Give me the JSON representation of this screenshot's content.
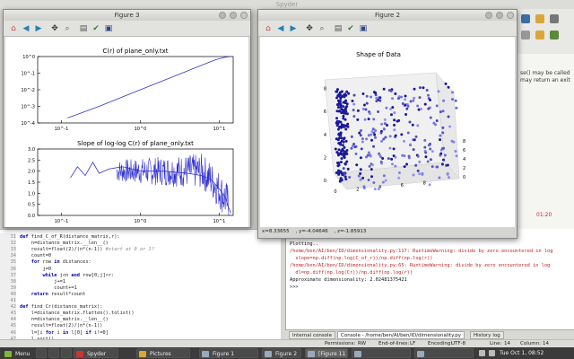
{
  "spyder": {
    "title": "Spyder",
    "doc_lines": [
      "se() may be called",
      "may return an exit"
    ],
    "timer": "01:20"
  },
  "editor": {
    "lines": [
      {
        "n": "31",
        "segs": [
          [
            "kw",
            "def "
          ],
          [
            "",
            "find_C_of_R(distance_matrix,r):"
          ]
        ]
      },
      {
        "n": "32",
        "segs": [
          [
            "",
            "    n=distance_matrix.__len__()"
          ]
        ]
      },
      {
        "n": "33",
        "segs": [
          [
            "",
            "    result=float(2)/(n*(n-1)) "
          ],
          [
            "cm",
            "#start at 0 or 1?"
          ]
        ]
      },
      {
        "n": "34",
        "segs": [
          [
            "",
            "    count=0"
          ]
        ]
      },
      {
        "n": "35",
        "segs": [
          [
            "kw",
            "    for "
          ],
          [
            "",
            "row "
          ],
          [
            "kw",
            "in "
          ],
          [
            "",
            "distances:"
          ]
        ]
      },
      {
        "n": "36",
        "segs": [
          [
            "",
            "        j=0"
          ]
        ]
      },
      {
        "n": "37",
        "segs": [
          [
            "kw",
            "        while "
          ],
          [
            "",
            "j<n "
          ],
          [
            "kw",
            "and "
          ],
          [
            "",
            "row[0,j]<r:"
          ]
        ]
      },
      {
        "n": "38",
        "segs": [
          [
            "",
            "            j+=1"
          ]
        ]
      },
      {
        "n": "39",
        "segs": [
          [
            "",
            "            count+=1"
          ]
        ]
      },
      {
        "n": "40",
        "segs": [
          [
            "kw",
            "    return "
          ],
          [
            "",
            "result*count"
          ]
        ]
      },
      {
        "n": "41",
        "segs": [
          [
            "",
            ""
          ]
        ]
      },
      {
        "n": "42",
        "segs": [
          [
            "kw",
            "def "
          ],
          [
            "",
            "find_Cr(distance_matrix):"
          ]
        ]
      },
      {
        "n": "43",
        "segs": [
          [
            "",
            "    l=distance_matrix.flatten().tolist()"
          ]
        ]
      },
      {
        "n": "44",
        "segs": [
          [
            "",
            "    n=distance_matrix.__len__()"
          ]
        ]
      },
      {
        "n": "45",
        "segs": [
          [
            "",
            "    result=float(2)/(n*(n-1))"
          ]
        ]
      },
      {
        "n": "46",
        "segs": [
          [
            "",
            "    l=[i "
          ],
          [
            "kw",
            "for "
          ],
          [
            "",
            "i "
          ],
          [
            "kw",
            "in "
          ],
          [
            "",
            "l[0] "
          ],
          [
            "kw",
            "if "
          ],
          [
            "",
            "i!=0]"
          ]
        ]
      },
      {
        "n": "47",
        "segs": [
          [
            "",
            "    l.sort()"
          ]
        ]
      }
    ]
  },
  "console": {
    "lines": [
      {
        "t": "Plotting..",
        "err": false
      },
      {
        "t": "/home/ben/AI/ben/ID/dimensionality.py:117: RuntimeWarning: divide by zero encountered in log",
        "err": true
      },
      {
        "t": "  slope=np.diff(np.log(C_of_r))/np.diff(np.log(r))",
        "err": true
      },
      {
        "t": "/home/ben/AI/ben/ID/dimensionality.py:65: RuntimeWarning: divide by zero encountered in log",
        "err": true
      },
      {
        "t": "  dl=np.diff(np.log(Cr))/np.diff(np.log(r))",
        "err": true
      },
      {
        "t": "Approximate dimensionality: 2.02481375421",
        "err": false
      },
      {
        "t": ">>>",
        "err": false
      }
    ],
    "tabs": [
      "Internal console",
      "Console - /home/ben/AI/ben/ID/dimensionality.py",
      "History log"
    ]
  },
  "statusbar": {
    "permissions_label": "Permissions:",
    "permissions": "RW",
    "eol_label": "End-of-lines:",
    "eol": "LF",
    "encoding_label": "Encoding:",
    "encoding": "UTF-8",
    "line_label": "Line:",
    "line": "14",
    "column_label": "Column:",
    "column": "14"
  },
  "taskbar": {
    "menu": "Menu",
    "tasks": [
      "Spyder",
      "Pictures",
      "Figure 1",
      "Figure 2",
      "[Figure 11",
      "",
      ""
    ],
    "clock": "Tue Oct  1, 08:52"
  },
  "figure3": {
    "title": "Figure 3",
    "colors": {
      "line": "#3030d0"
    },
    "chart_data": [
      {
        "type": "line",
        "title": "C(r) of plane_only.txt",
        "xscale": "log",
        "yscale": "log",
        "xlim": [
          0.05,
          15
        ],
        "ylim": [
          0.0001,
          1
        ],
        "xticks": [
          "10^-1",
          "10^0",
          "10^1"
        ],
        "yticks": [
          "10^-4",
          "10^-3",
          "10^-2",
          "10^-1",
          "10^0"
        ],
        "series": [
          {
            "x": [
              0.12,
              0.3,
              1,
              3,
              6,
              9,
              12,
              14
            ],
            "values": [
              0.0002,
              0.001,
              0.01,
              0.08,
              0.3,
              0.65,
              0.92,
              1.0
            ]
          }
        ]
      },
      {
        "type": "line",
        "title": "Slope of log-log C(r) of plane_only.txt",
        "xscale": "log",
        "xlim": [
          0.05,
          15
        ],
        "ylim": [
          0,
          3.0
        ],
        "yticks": [
          "0.0",
          "0.5",
          "1.0",
          "1.5",
          "2.0",
          "2.5",
          "3.0"
        ],
        "xticks": [
          "10^-1",
          "10^0",
          "10^1"
        ],
        "series": [
          {
            "x": [
              0.13,
              0.16,
              0.2,
              0.25,
              0.3,
              0.4,
              0.6,
              1,
              2,
              4,
              6,
              8,
              10,
              12,
              13,
              14
            ],
            "values": [
              1.7,
              2.2,
              1.8,
              2.4,
              1.9,
              2.1,
              2.2,
              2.0,
              2.0,
              1.9,
              1.8,
              1.6,
              1.2,
              0.8,
              0.4,
              0.1
            ]
          }
        ]
      }
    ]
  },
  "figure2": {
    "title": "Figure 2",
    "status": "x=8.33655    , y=-4.04646    , z=-1.85913",
    "colors": {
      "points": "#1a1a9a"
    },
    "chart_data": {
      "type": "scatter",
      "title": "Shape of Data",
      "dims": 3,
      "xticks": [
        "0",
        "2",
        "4",
        "6",
        "8"
      ],
      "yticks": [
        "0",
        "2",
        "4",
        "6",
        "8"
      ],
      "zticks": [
        "0",
        "2",
        "4",
        "6",
        "8"
      ],
      "xlim": [
        0,
        10
      ],
      "ylim": [
        0,
        10
      ],
      "zlim": [
        0,
        8
      ],
      "points": [
        [
          0.2,
          0,
          1.5
        ],
        [
          0.3,
          0,
          3.2
        ],
        [
          0.1,
          0,
          5.0
        ],
        [
          0.4,
          0,
          6.8
        ],
        [
          0.2,
          0,
          7.9
        ],
        [
          0.6,
          0,
          2.2
        ],
        [
          0.5,
          0,
          4.1
        ],
        [
          0.7,
          0,
          5.9
        ],
        [
          0.3,
          0,
          0.6
        ],
        [
          0.8,
          0,
          7.2
        ],
        [
          1,
          1,
          1
        ],
        [
          2,
          2,
          2
        ],
        [
          3,
          3,
          3
        ],
        [
          4,
          1,
          4
        ],
        [
          5,
          2,
          5
        ],
        [
          6,
          3,
          6
        ],
        [
          7,
          4,
          7
        ],
        [
          8,
          5,
          1
        ],
        [
          9,
          6,
          2
        ],
        [
          2,
          7,
          3
        ],
        [
          3,
          8,
          4
        ],
        [
          4,
          9,
          5
        ],
        [
          5,
          1,
          6
        ],
        [
          6,
          2,
          7
        ],
        [
          7,
          3,
          0.5
        ],
        [
          8,
          4,
          1.5
        ],
        [
          9,
          5,
          2.5
        ],
        [
          1,
          6,
          3.5
        ],
        [
          2,
          7,
          4.5
        ],
        [
          3,
          8,
          5.5
        ],
        [
          4,
          9,
          6.5
        ],
        [
          5,
          0.5,
          7.5
        ],
        [
          6,
          1.5,
          0.8
        ],
        [
          7,
          2.5,
          1.8
        ],
        [
          8,
          3.5,
          2.8
        ],
        [
          9,
          4.5,
          3.8
        ],
        [
          1.5,
          5.5,
          4.8
        ],
        [
          2.5,
          6.5,
          5.8
        ],
        [
          3.5,
          7.5,
          6.8
        ],
        [
          4.5,
          8.5,
          7.8
        ]
      ]
    }
  }
}
